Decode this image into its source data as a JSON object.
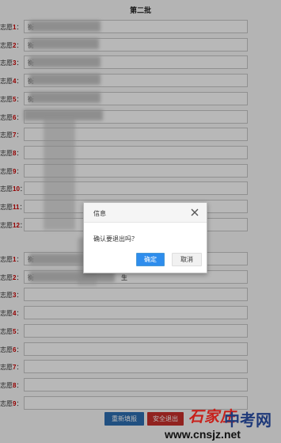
{
  "batch": {
    "title": "第二批"
  },
  "group1": {
    "rows": [
      {
        "prefix": "志愿",
        "num": "1",
        "suffix": "：",
        "value": "衡"
      },
      {
        "prefix": "志愿",
        "num": "2",
        "suffix": "：",
        "value": "衡"
      },
      {
        "prefix": "志愿",
        "num": "3",
        "suffix": "：",
        "value": "衡"
      },
      {
        "prefix": "志愿",
        "num": "4",
        "suffix": "：",
        "value": "衡"
      },
      {
        "prefix": "志愿",
        "num": "5",
        "suffix": "：",
        "value": "衡"
      },
      {
        "prefix": "志愿",
        "num": "6",
        "suffix": "：",
        "value": ""
      },
      {
        "prefix": "志愿",
        "num": "7",
        "suffix": "：",
        "value": ""
      },
      {
        "prefix": "志愿",
        "num": "8",
        "suffix": "：",
        "value": ""
      },
      {
        "prefix": "志愿",
        "num": "9",
        "suffix": "：",
        "value": ""
      },
      {
        "prefix": "志愿",
        "num": "10",
        "suffix": "：",
        "value": ""
      },
      {
        "prefix": "志愿",
        "num": "11",
        "suffix": "：",
        "value": ""
      },
      {
        "prefix": "志愿",
        "num": "12",
        "suffix": "：",
        "value": ""
      }
    ]
  },
  "group2": {
    "rows": [
      {
        "prefix": "志愿",
        "num": "1",
        "suffix": "：",
        "value": "衡"
      },
      {
        "prefix": "志愿",
        "num": "2",
        "suffix": "：",
        "value": "衡",
        "tail": "生"
      },
      {
        "prefix": "志愿",
        "num": "3",
        "suffix": "：",
        "value": ""
      },
      {
        "prefix": "志愿",
        "num": "4",
        "suffix": "：",
        "value": ""
      },
      {
        "prefix": "志愿",
        "num": "5",
        "suffix": "：",
        "value": ""
      },
      {
        "prefix": "志愿",
        "num": "6",
        "suffix": "：",
        "value": ""
      },
      {
        "prefix": "志愿",
        "num": "7",
        "suffix": "：",
        "value": ""
      },
      {
        "prefix": "志愿",
        "num": "8",
        "suffix": "：",
        "value": ""
      },
      {
        "prefix": "志愿",
        "num": "9",
        "suffix": "：",
        "value": ""
      }
    ]
  },
  "dialog": {
    "title": "信息",
    "message": "确认要退出吗？",
    "ok_label": "确定",
    "cancel_label": "取消"
  },
  "footer": {
    "reset_label": "重新填报",
    "exit_label": "安全退出"
  },
  "watermark": {
    "logo_text": "石家庄",
    "site_name": "中考网",
    "url": "www.cnsjz.net"
  },
  "colors": {
    "label_number": "#cc0000",
    "ok_button": "#2e8ded",
    "reset_button": "#2f6fb3",
    "exit_button": "#c9302c"
  }
}
